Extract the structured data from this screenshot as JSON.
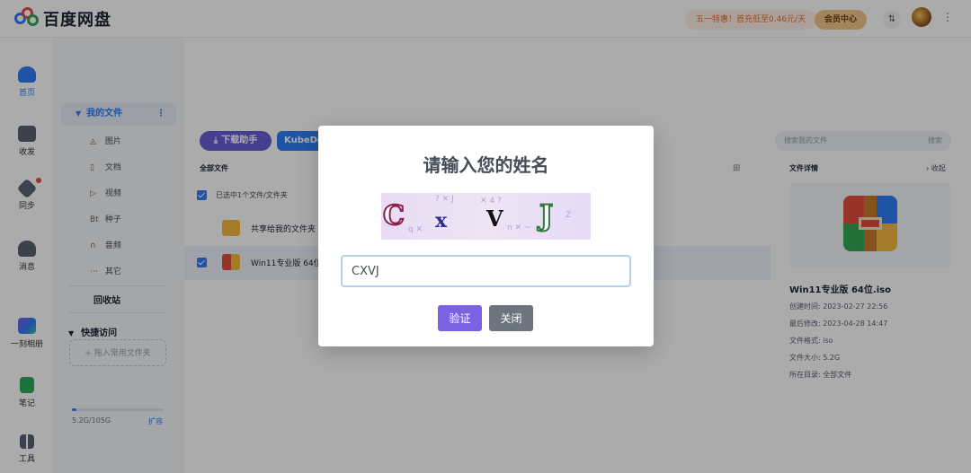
{
  "header": {
    "logo_text": "百度网盘",
    "promo": "五一特惠！首充低至0.46元/天",
    "vip_label": "会员中心",
    "transfer_icon": "transfer-icon",
    "more_icon": "more-vertical-icon"
  },
  "rail": {
    "items": [
      {
        "label": "首页",
        "icon": "home-cloud-icon",
        "active": true
      },
      {
        "label": "收发",
        "icon": "share-folder-icon"
      },
      {
        "label": "同步",
        "icon": "sync-icon"
      },
      {
        "label": "消息",
        "icon": "message-icon"
      },
      {
        "label": "一刻相册",
        "icon": "album-icon"
      },
      {
        "label": "笔记",
        "icon": "note-icon"
      },
      {
        "label": "工具",
        "icon": "tools-icon"
      }
    ]
  },
  "sidebar": {
    "my_files": "我的文件",
    "categories": [
      {
        "label": "图片",
        "icon": "image-icon"
      },
      {
        "label": "文档",
        "icon": "document-icon"
      },
      {
        "label": "视频",
        "icon": "video-icon"
      },
      {
        "label": "种子",
        "icon": "bt-icon"
      },
      {
        "label": "音频",
        "icon": "headphones-icon"
      },
      {
        "label": "其它",
        "icon": "more-horizontal-icon"
      }
    ],
    "recycle": "回收站",
    "quick_access": "快捷访问",
    "drop_hint": "+ 拖入常用文件夹",
    "quota_text": "5.2G/105G",
    "quota_fraction": 0.05,
    "expand_link": "扩容"
  },
  "main": {
    "download_btn": "下载助手",
    "kube_btn": "KubeDo",
    "breadcrumb": "全部文件",
    "selection": "已选中1个文件/文件夹",
    "files": [
      {
        "name": "共享给我的文件夹",
        "icon": "folder-icon",
        "selected": false
      },
      {
        "name": "Win11专业版 64位",
        "icon": "archive-icon",
        "selected": true
      }
    ]
  },
  "details": {
    "search_placeholder": "搜索我的文件",
    "search_btn": "搜索",
    "title": "文件详情",
    "collapse": "› 收起",
    "file_name": "Win11专业版 64位.iso",
    "created": "创建时间: 2023-02-27 22:56",
    "modified": "最后修改: 2023-04-28 14:47",
    "format": "文件格式: iso",
    "size": "文件大小: 5.2G",
    "location": "所在目录: 全部文件"
  },
  "dialog": {
    "title": "请输入您的姓名",
    "captcha_chars": [
      "C",
      "x",
      "V",
      "J"
    ],
    "input_value": "CXVJ",
    "verify_btn": "验证",
    "close_btn": "关闭"
  },
  "colors": {
    "accent": "#2f7cf6",
    "verify": "#7b62e3",
    "close": "#6c757d",
    "download": "#6a5dd6"
  }
}
